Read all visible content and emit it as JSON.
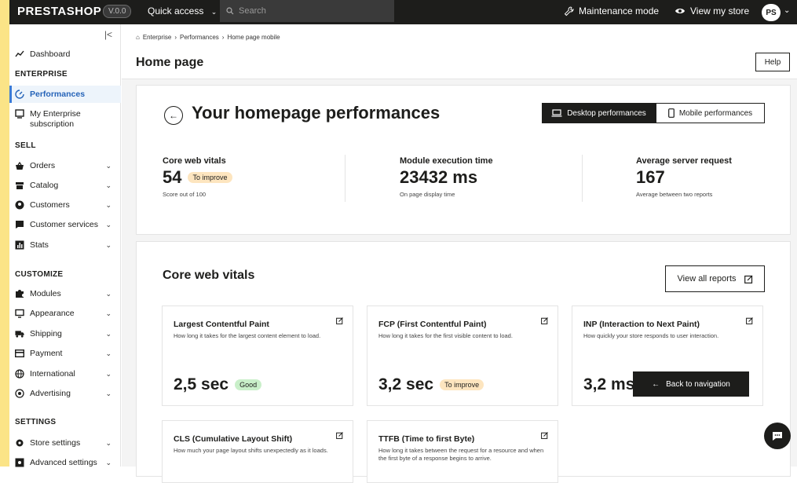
{
  "header": {
    "logo": "PRESTASHOP",
    "version": "V.0.0",
    "quick_access": "Quick access",
    "search_placeholder": "Search",
    "maintenance": "Maintenance mode",
    "view_store": "View my store",
    "avatar": "PS"
  },
  "sidebar": {
    "dashboard": "Dashboard",
    "sections": {
      "enterprise": "ENTERPRISE",
      "sell": "SELL",
      "customize": "CUSTOMIZE",
      "settings": "SETTINGS"
    },
    "performances": "Performances",
    "subscription": "My Enterprise subscription",
    "orders": "Orders",
    "catalog": "Catalog",
    "customers": "Customers",
    "customer_services": "Customer services",
    "stats": "Stats",
    "modules": "Modules",
    "appearance": "Appearance",
    "shipping": "Shipping",
    "payment": "Payment",
    "international": "International",
    "advertising": "Advertising",
    "store_settings": "Store settings",
    "advanced_settings": "Advanced settings"
  },
  "breadcrumb": [
    "Enterprise",
    "Performances",
    "Home page mobile"
  ],
  "page_title": "Home page",
  "help": "Help",
  "hero": {
    "title": "Your homepage performances",
    "desktop": "Desktop performances",
    "mobile": "Mobile performances"
  },
  "metrics": {
    "cwv_title": "Core web vitals",
    "cwv_value": "54",
    "cwv_badge": "To improve",
    "cwv_sub": "Score out of 100",
    "met_title": "Module execution time",
    "met_value": "23432 ms",
    "met_sub": "On page display time",
    "asr_title": "Average server request",
    "asr_value": "167",
    "asr_sub": "Average between two reports"
  },
  "vitals": {
    "section_title": "Core web vitals",
    "view_all": "View all reports",
    "lcp_title": "Largest Contentful Paint",
    "lcp_desc": "How long it takes for the largest content element to load.",
    "lcp_value": "2,5 sec",
    "lcp_badge": "Good",
    "fcp_title": "FCP (First Contentful Paint)",
    "fcp_desc": "How long it takes for the first visible content to load.",
    "fcp_value": "3,2 sec",
    "fcp_badge": "To improve",
    "inp_title": "INP (Interaction to Next Paint)",
    "inp_desc": "How quickly your store responds to user interaction.",
    "inp_value": "3,2 ms",
    "cls_title": "CLS (Cumulative Layout Shift)",
    "cls_desc": "How much your page layout shifts unexpectedly as it loads.",
    "ttfb_title": "TTFB (Time to first Byte)",
    "ttfb_desc": "How long it takes between the request for a resource and when the first byte of a response begins to arrive."
  },
  "toast": "Back to navigation",
  "colors": {
    "accent": "#2563b8",
    "dark": "#1d1d1b",
    "frame": "#fbe487"
  }
}
